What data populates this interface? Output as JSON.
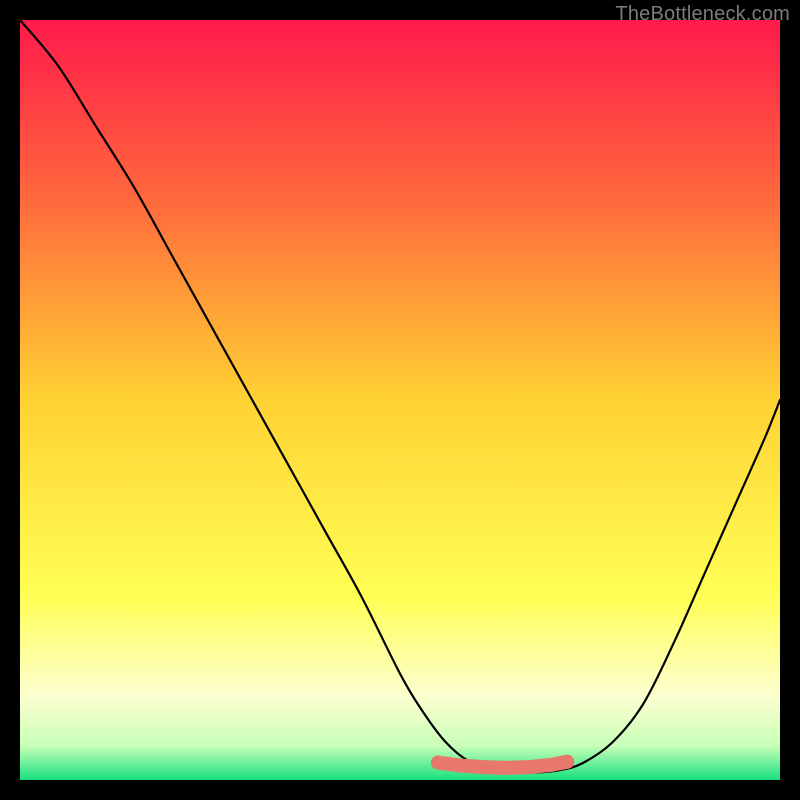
{
  "watermark": "TheBottleneck.com",
  "colors": {
    "top": "#ff1a4b",
    "mid_upper": "#ff6a3c",
    "mid": "#ffd233",
    "mid_lower": "#ffff55",
    "lower_pale": "#fdffd0",
    "bottom": "#18e07e",
    "curve": "#000000",
    "marker_fill": "#e8776c",
    "marker_stroke": "#c94f46"
  },
  "chart_data": {
    "type": "line",
    "title": "",
    "xlabel": "",
    "ylabel": "",
    "xlim": [
      0,
      100
    ],
    "ylim": [
      0,
      100
    ],
    "series": [
      {
        "name": "bottleneck-curve",
        "x": [
          0,
          5,
          10,
          15,
          20,
          25,
          30,
          35,
          40,
          45,
          50,
          53,
          56,
          59,
          62,
          65,
          68,
          71,
          74,
          78,
          82,
          86,
          90,
          94,
          98,
          100
        ],
        "y": [
          100,
          94,
          86,
          78,
          69,
          60,
          51,
          42,
          33,
          24,
          14,
          9,
          5,
          2.5,
          1.5,
          1,
          1,
          1.3,
          2.2,
          5,
          10,
          18,
          27,
          36,
          45,
          50
        ]
      }
    ],
    "markers": {
      "name": "optimal-range",
      "x": [
        55,
        58,
        61,
        64,
        67,
        70,
        72
      ],
      "y": [
        2.3,
        1.9,
        1.7,
        1.6,
        1.7,
        2.0,
        2.4
      ]
    }
  }
}
